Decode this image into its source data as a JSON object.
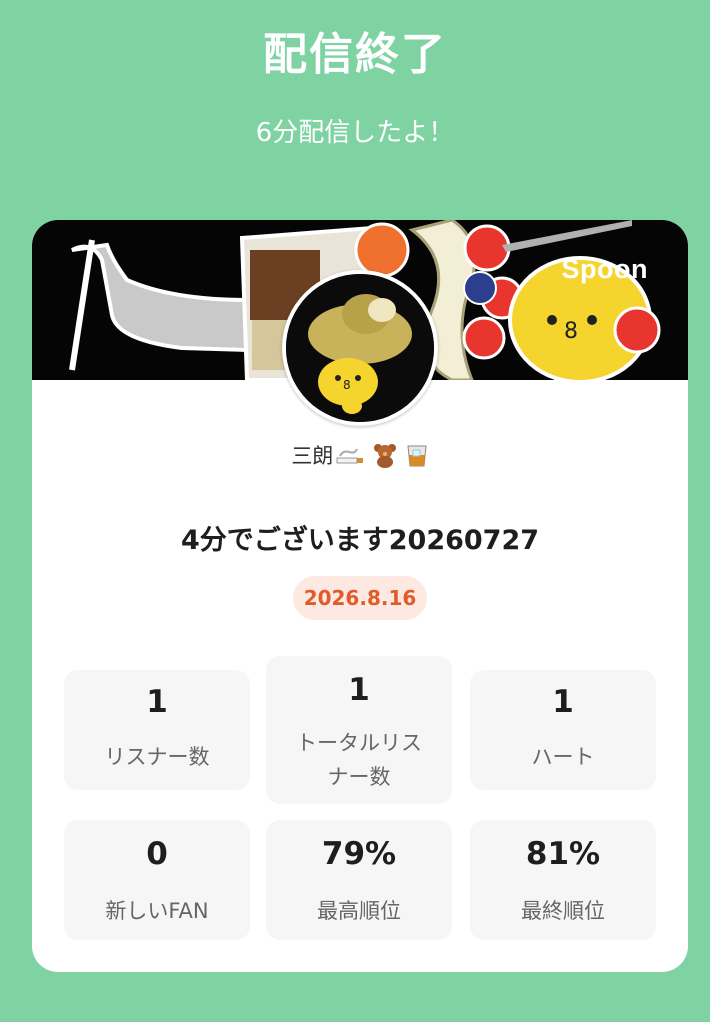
{
  "header": {
    "title": "配信終了",
    "subtitle": "6分配信したよ！"
  },
  "card": {
    "brand": "Spoon",
    "dj_name": "三朗",
    "dj_name_emoji_icons": [
      "cigarette-icon",
      "teddy-bear-icon",
      "whiskey-glass-icon"
    ],
    "live_title": "4分でございます20260727",
    "date": "2026.8.16"
  },
  "stats": [
    {
      "value": "1",
      "label": "リスナー数"
    },
    {
      "value": "1",
      "label": "トータルリス\nナー数"
    },
    {
      "value": "1",
      "label": "ハート"
    },
    {
      "value": "0",
      "label": "新しいFAN"
    },
    {
      "value": "79%",
      "label": "最高順位"
    },
    {
      "value": "81%",
      "label": "最終順位"
    }
  ],
  "colors": {
    "background": "#7fd3a3",
    "card": "#ffffff",
    "stat_tile": "#f6f6f6",
    "date_badge_bg": "#fde9e1",
    "date_badge_text": "#e05a2a"
  }
}
